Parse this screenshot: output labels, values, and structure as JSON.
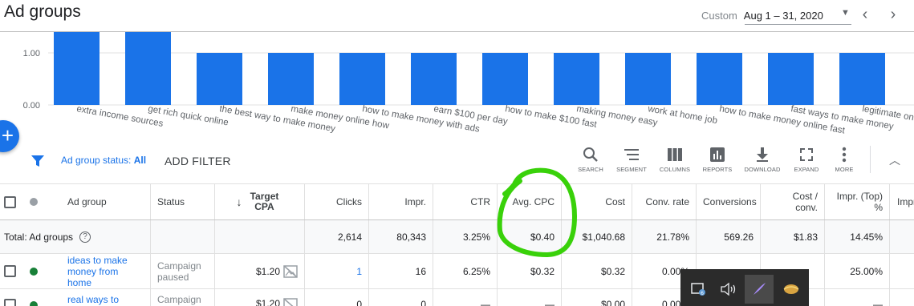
{
  "header": {
    "title": "Ad groups",
    "date_mode": "Custom",
    "date_range": "Aug 1 – 31, 2020"
  },
  "chart_data": {
    "type": "bar",
    "ylim": [
      0,
      1
    ],
    "yticks": [
      "1.00",
      "0.00"
    ],
    "categories": [
      "extra income sources",
      "get rich quick online",
      "the best way to make money",
      "make money online how",
      "how to make money with ads",
      "earn $100 per day",
      "how to make $100 fast",
      "making money easy",
      "work at home job",
      "how to make money online fast",
      "fast ways to make money",
      "legitimate on"
    ],
    "values": [
      1.4,
      1.4,
      1,
      1,
      1,
      1,
      1,
      1,
      1,
      1,
      1,
      1
    ],
    "color": "#1a73e8"
  },
  "filter": {
    "status_label": "Ad group status:",
    "status_value": "All",
    "add_filter": "ADD FILTER"
  },
  "toolbar": [
    {
      "label": "SEARCH",
      "icon": "search-icon"
    },
    {
      "label": "SEGMENT",
      "icon": "segment-icon"
    },
    {
      "label": "COLUMNS",
      "icon": "columns-icon"
    },
    {
      "label": "REPORTS",
      "icon": "reports-icon"
    },
    {
      "label": "DOWNLOAD",
      "icon": "download-icon"
    },
    {
      "label": "EXPAND",
      "icon": "expand-icon"
    },
    {
      "label": "MORE",
      "icon": "more-icon"
    }
  ],
  "table": {
    "headers": {
      "ad_group": "Ad group",
      "status": "Status",
      "target_cpa": "Target CPA",
      "clicks": "Clicks",
      "impr": "Impr.",
      "ctr": "CTR",
      "avg_cpc": "Avg. CPC",
      "cost": "Cost",
      "conv_rate": "Conv. rate",
      "conversions": "Conversions",
      "cost_conv": "Cost / conv.",
      "impr_top": "Impr. (Top) %",
      "impr_abs": "Impr"
    },
    "total": {
      "label": "Total: Ad groups",
      "clicks": "2,614",
      "impr": "80,343",
      "ctr": "3.25%",
      "avg_cpc": "$0.40",
      "cost": "$1,040.68",
      "conv_rate": "21.78%",
      "conversions": "569.26",
      "cost_conv": "$1.83",
      "impr_top": "14.45%"
    },
    "rows": [
      {
        "name": "ideas to make money from home",
        "status": "Campaign paused",
        "target_cpa": "$1.20",
        "clicks": "1",
        "impr": "16",
        "ctr": "6.25%",
        "avg_cpc": "$0.32",
        "cost": "$0.32",
        "conv_rate": "0.00%",
        "impr_top": "25.00%"
      },
      {
        "name": "real ways to",
        "status": "Campaign",
        "target_cpa": "$1.20",
        "clicks": "0",
        "impr": "0",
        "ctr": "—",
        "avg_cpc": "—",
        "cost": "$0.00",
        "conv_rate": "0.00%",
        "impr_top": "—"
      }
    ]
  },
  "annotation_color": "#39d10a"
}
